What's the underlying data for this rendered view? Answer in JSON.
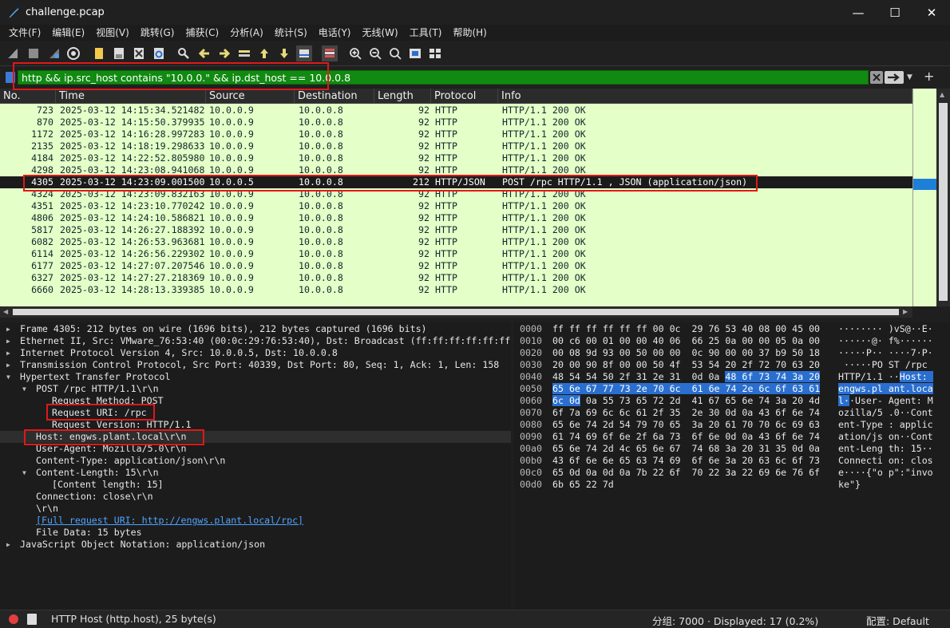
{
  "window": {
    "title": "challenge.pcap",
    "min": "—",
    "max": "☐",
    "close": "✕"
  },
  "menu": [
    "文件(F)",
    "编辑(E)",
    "视图(V)",
    "跳转(G)",
    "捕获(C)",
    "分析(A)",
    "统计(S)",
    "电话(Y)",
    "无线(W)",
    "工具(T)",
    "帮助(H)"
  ],
  "filter": {
    "value": "http && ip.src_host contains \"10.0.0.\" && ip.dst_host == 10.0.0.8",
    "plus": "+"
  },
  "columns": [
    "No.",
    "Time",
    "Source",
    "Destination",
    "Length",
    "Protocol",
    "Info"
  ],
  "packets": [
    [
      "723",
      "2025-03-12 14:15:34.521482",
      "10.0.0.9",
      "10.0.0.8",
      "92",
      "HTTP",
      "HTTP/1.1 200 OK"
    ],
    [
      "870",
      "2025-03-12 14:15:50.379935",
      "10.0.0.9",
      "10.0.0.8",
      "92",
      "HTTP",
      "HTTP/1.1 200 OK"
    ],
    [
      "1172",
      "2025-03-12 14:16:28.997283",
      "10.0.0.9",
      "10.0.0.8",
      "92",
      "HTTP",
      "HTTP/1.1 200 OK"
    ],
    [
      "2135",
      "2025-03-12 14:18:19.298633",
      "10.0.0.9",
      "10.0.0.8",
      "92",
      "HTTP",
      "HTTP/1.1 200 OK"
    ],
    [
      "4184",
      "2025-03-12 14:22:52.805980",
      "10.0.0.9",
      "10.0.0.8",
      "92",
      "HTTP",
      "HTTP/1.1 200 OK"
    ],
    [
      "4298",
      "2025-03-12 14:23:08.941068",
      "10.0.0.9",
      "10.0.0.8",
      "92",
      "HTTP",
      "HTTP/1.1 200 OK"
    ],
    [
      "4305",
      "2025-03-12 14:23:09.001500",
      "10.0.0.5",
      "10.0.0.8",
      "212",
      "HTTP/JSON",
      "POST /rpc HTTP/1.1 , JSON (application/json)"
    ],
    [
      "4324",
      "2025-03-12 14:23:09.832163",
      "10.0.0.9",
      "10.0.0.8",
      "92",
      "HTTP",
      "HTTP/1.1 200 OK"
    ],
    [
      "4351",
      "2025-03-12 14:23:10.770242",
      "10.0.0.9",
      "10.0.0.8",
      "92",
      "HTTP",
      "HTTP/1.1 200 OK"
    ],
    [
      "4806",
      "2025-03-12 14:24:10.586821",
      "10.0.0.9",
      "10.0.0.8",
      "92",
      "HTTP",
      "HTTP/1.1 200 OK"
    ],
    [
      "5817",
      "2025-03-12 14:26:27.188392",
      "10.0.0.9",
      "10.0.0.8",
      "92",
      "HTTP",
      "HTTP/1.1 200 OK"
    ],
    [
      "6082",
      "2025-03-12 14:26:53.963681",
      "10.0.0.9",
      "10.0.0.8",
      "92",
      "HTTP",
      "HTTP/1.1 200 OK"
    ],
    [
      "6114",
      "2025-03-12 14:26:56.229302",
      "10.0.0.9",
      "10.0.0.8",
      "92",
      "HTTP",
      "HTTP/1.1 200 OK"
    ],
    [
      "6177",
      "2025-03-12 14:27:07.207546",
      "10.0.0.9",
      "10.0.0.8",
      "92",
      "HTTP",
      "HTTP/1.1 200 OK"
    ],
    [
      "6327",
      "2025-03-12 14:27:27.218369",
      "10.0.0.9",
      "10.0.0.8",
      "92",
      "HTTP",
      "HTTP/1.1 200 OK"
    ],
    [
      "6660",
      "2025-03-12 14:28:13.339385",
      "10.0.0.9",
      "10.0.0.8",
      "92",
      "HTTP",
      "HTTP/1.1 200 OK"
    ]
  ],
  "selected_packet": "4305",
  "details": [
    {
      "text": "Frame 4305: 212 bytes on wire (1696 bits), 212 bytes captured (1696 bits)",
      "level": 0,
      "arrow": "▶"
    },
    {
      "text": "Ethernet II, Src: VMware_76:53:40 (00:0c:29:76:53:40), Dst: Broadcast (ff:ff:ff:ff:ff:ff)",
      "level": 0,
      "arrow": "▶"
    },
    {
      "text": "Internet Protocol Version 4, Src: 10.0.0.5, Dst: 10.0.0.8",
      "level": 0,
      "arrow": "▶"
    },
    {
      "text": "Transmission Control Protocol, Src Port: 40339, Dst Port: 80, Seq: 1, Ack: 1, Len: 158",
      "level": 0,
      "arrow": "▶"
    },
    {
      "text": "Hypertext Transfer Protocol",
      "level": 0,
      "arrow": "▼"
    },
    {
      "text": "POST /rpc HTTP/1.1\\r\\n",
      "level": 1,
      "arrow": "▼"
    },
    {
      "text": "Request Method: POST",
      "level": 2,
      "arrow": ""
    },
    {
      "text": "Request URI: /rpc",
      "level": 2,
      "arrow": ""
    },
    {
      "text": "Request Version: HTTP/1.1",
      "level": 2,
      "arrow": ""
    },
    {
      "text": "Host: engws.plant.local\\r\\n",
      "level": 1,
      "arrow": ""
    },
    {
      "text": "User-Agent: Mozilla/5.0\\r\\n",
      "level": 1,
      "arrow": ""
    },
    {
      "text": "Content-Type: application/json\\r\\n",
      "level": 1,
      "arrow": ""
    },
    {
      "text": "Content-Length: 15\\r\\n",
      "level": 1,
      "arrow": "▼"
    },
    {
      "text": "[Content length: 15]",
      "level": 2,
      "arrow": ""
    },
    {
      "text": "Connection: close\\r\\n",
      "level": 1,
      "arrow": ""
    },
    {
      "text": "\\r\\n",
      "level": 1,
      "arrow": ""
    },
    {
      "text": "[Full request URI: http://engws.plant.local/rpc]",
      "level": 1,
      "arrow": "",
      "link": true
    },
    {
      "text": "File Data: 15 bytes",
      "level": 1,
      "arrow": ""
    },
    {
      "text": "JavaScript Object Notation: application/json",
      "level": 0,
      "arrow": "▶"
    }
  ],
  "bytes": [
    {
      "off": "0000",
      "hex": "ff ff ff ff ff ff 00 0c  29 76 53 40 08 00 45 00",
      "ascii": "········ )vS@··E·"
    },
    {
      "off": "0010",
      "hex": "00 c6 00 01 00 00 40 06  66 25 0a 00 00 05 0a 00",
      "ascii": "······@· f%······"
    },
    {
      "off": "0020",
      "hex": "00 08 9d 93 00 50 00 00  0c 90 00 00 37 b9 50 18",
      "ascii": "·····P·· ····7·P·"
    },
    {
      "off": "0030",
      "hex": "20 00 90 8f 00 00 50 4f  53 54 20 2f 72 70 63 20",
      "ascii": " ·····PO ST /rpc "
    },
    {
      "off": "0040",
      "hex": "48 54 54 50 2f 31 2e 31  0d 0a 48 6f 73 74 3a 20",
      "ascii": "HTTP/1.1 ··Host: "
    },
    {
      "off": "0050",
      "hex": "65 6e 67 77 73 2e 70 6c  61 6e 74 2e 6c 6f 63 61",
      "ascii": "engws.pl ant.loca"
    },
    {
      "off": "0060",
      "hex": "6c 0d 0a 55 73 65 72 2d  41 67 65 6e 74 3a 20 4d",
      "ascii": "l··User- Agent: M"
    },
    {
      "off": "0070",
      "hex": "6f 7a 69 6c 6c 61 2f 35  2e 30 0d 0a 43 6f 6e 74",
      "ascii": "ozilla/5 .0··Cont"
    },
    {
      "off": "0080",
      "hex": "65 6e 74 2d 54 79 70 65  3a 20 61 70 70 6c 69 63",
      "ascii": "ent-Type : applic"
    },
    {
      "off": "0090",
      "hex": "61 74 69 6f 6e 2f 6a 73  6f 6e 0d 0a 43 6f 6e 74",
      "ascii": "ation/js on··Cont"
    },
    {
      "off": "00a0",
      "hex": "65 6e 74 2d 4c 65 6e 67  74 68 3a 20 31 35 0d 0a",
      "ascii": "ent-Leng th: 15··"
    },
    {
      "off": "00b0",
      "hex": "43 6f 6e 6e 65 63 74 69  6f 6e 3a 20 63 6c 6f 73",
      "ascii": "Connecti on: clos"
    },
    {
      "off": "00c0",
      "hex": "65 0d 0a 0d 0a 7b 22 6f  70 22 3a 22 69 6e 76 6f",
      "ascii": "e····{\"o p\":\"invo"
    },
    {
      "off": "00d0",
      "hex": "6b 65 22 7d",
      "ascii": "ke\"}"
    }
  ],
  "status": {
    "field": "HTTP Host (http.host), 25 byte(s)",
    "packets": "分组: 7000 · Displayed: 17 (0.2%)",
    "profile": "配置: Default"
  },
  "colors": {
    "filter_ok": "#108a10",
    "list_bg": "#e4ffc7",
    "selection": "#2a6fd0",
    "annotation": "#e01818"
  }
}
